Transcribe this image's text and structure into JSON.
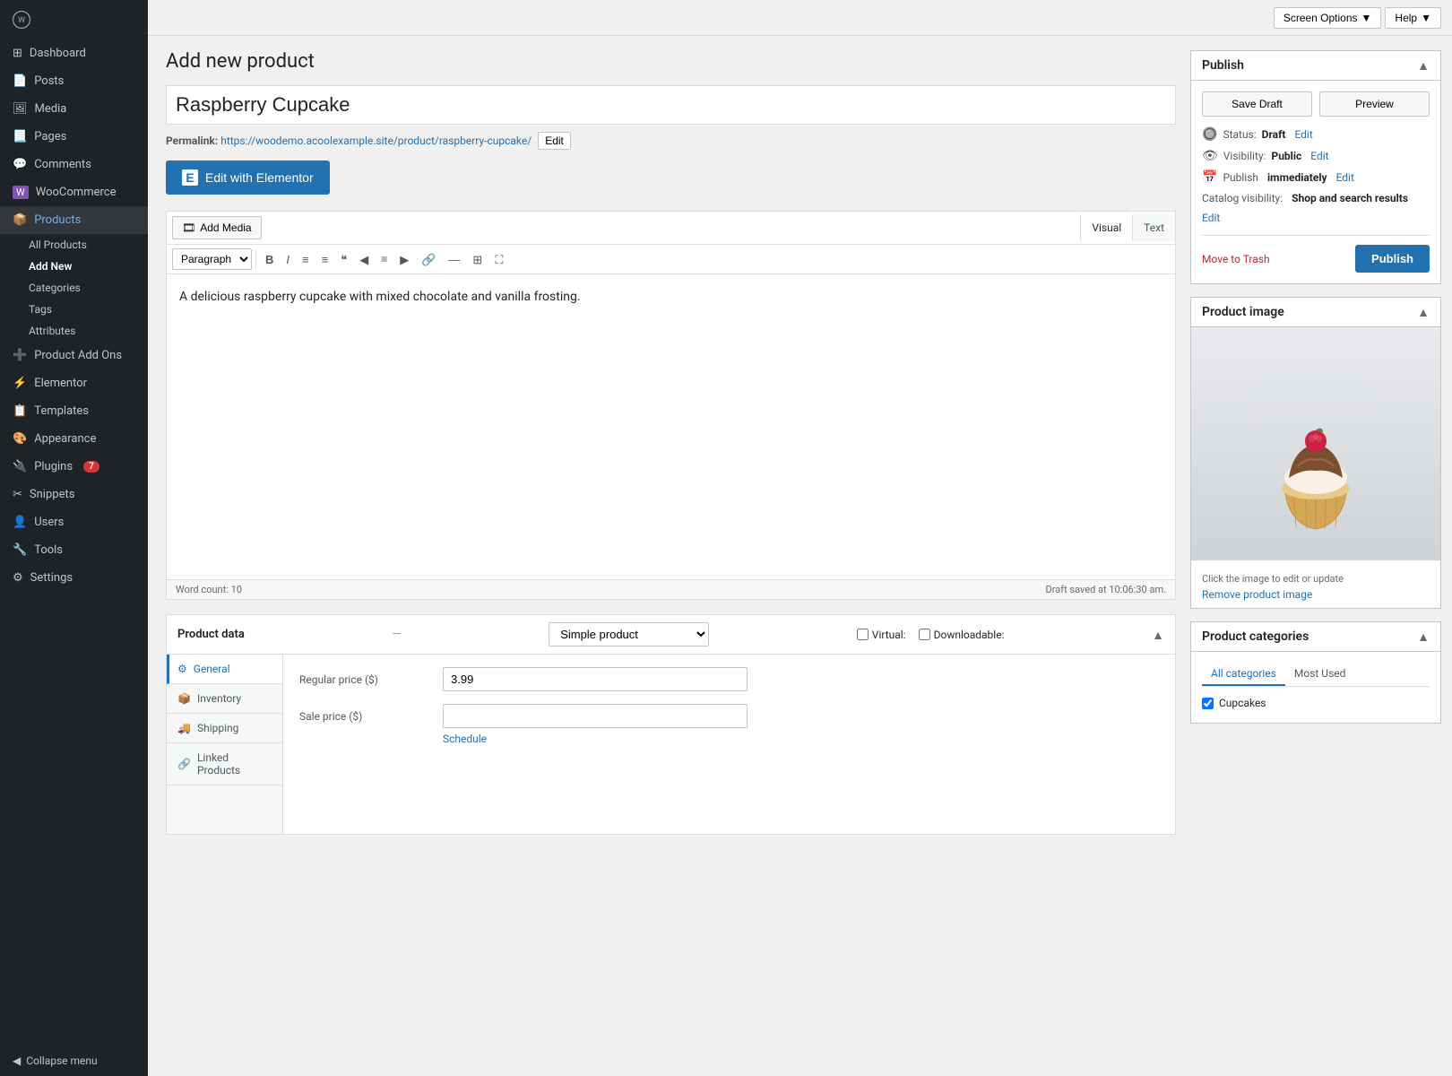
{
  "topbar": {
    "screen_options": "Screen Options",
    "help": "Help"
  },
  "sidebar": {
    "logo": "W",
    "items": [
      {
        "id": "dashboard",
        "label": "Dashboard",
        "icon": "⊞"
      },
      {
        "id": "posts",
        "label": "Posts",
        "icon": "📄"
      },
      {
        "id": "media",
        "label": "Media",
        "icon": "🖼"
      },
      {
        "id": "pages",
        "label": "Pages",
        "icon": "📃"
      },
      {
        "id": "comments",
        "label": "Comments",
        "icon": "💬"
      },
      {
        "id": "woocommerce",
        "label": "WooCommerce",
        "icon": "🛒"
      },
      {
        "id": "products",
        "label": "Products",
        "icon": "📦"
      },
      {
        "id": "product-add-ons",
        "label": "Product Add Ons",
        "icon": "➕"
      },
      {
        "id": "elementor",
        "label": "Elementor",
        "icon": "⚡"
      },
      {
        "id": "templates",
        "label": "Templates",
        "icon": "📋"
      },
      {
        "id": "appearance",
        "label": "Appearance",
        "icon": "🎨"
      },
      {
        "id": "plugins",
        "label": "Plugins",
        "icon": "🔌",
        "badge": "7"
      },
      {
        "id": "snippets",
        "label": "Snippets",
        "icon": "✂"
      },
      {
        "id": "users",
        "label": "Users",
        "icon": "👤"
      },
      {
        "id": "tools",
        "label": "Tools",
        "icon": "🔧"
      },
      {
        "id": "settings",
        "label": "Settings",
        "icon": "⚙"
      }
    ],
    "products_sub": [
      {
        "id": "all-products",
        "label": "All Products"
      },
      {
        "id": "add-new",
        "label": "Add New",
        "active": true
      },
      {
        "id": "categories",
        "label": "Categories"
      },
      {
        "id": "tags",
        "label": "Tags"
      },
      {
        "id": "attributes",
        "label": "Attributes"
      }
    ],
    "collapse": "Collapse menu"
  },
  "page": {
    "title": "Add new product",
    "product_title": "Raspberry Cupcake",
    "permalink_label": "Permalink:",
    "permalink_url": "https://woodemo.acoolexample.site/product/raspberry-cupcake/",
    "permalink_edit": "Edit"
  },
  "elementor_btn": "Edit with Elementor",
  "editor": {
    "add_media": "Add Media",
    "visual_tab": "Visual",
    "text_tab": "Text",
    "paragraph_label": "Paragraph",
    "toolbar_buttons": [
      "B",
      "I",
      "≡",
      "≡",
      "❝",
      "◀",
      "▶",
      "🔗",
      "—",
      "⊞",
      "⛶"
    ],
    "content": "A delicious raspberry cupcake with mixed chocolate and vanilla frosting.",
    "word_count": "Word count: 10",
    "draft_saved": "Draft saved at 10:06:30 am."
  },
  "product_data": {
    "label": "Product data",
    "type": "Simple product",
    "virtual_label": "Virtual:",
    "downloadable_label": "Downloadable:",
    "tabs": [
      {
        "id": "general",
        "label": "General",
        "icon": "⚙",
        "active": true
      },
      {
        "id": "inventory",
        "label": "Inventory",
        "icon": "📦"
      },
      {
        "id": "shipping",
        "label": "Shipping",
        "icon": "🚚"
      },
      {
        "id": "linked-products",
        "label": "Linked Products",
        "icon": "🔗"
      }
    ],
    "general": {
      "regular_price_label": "Regular price ($)",
      "regular_price_value": "3.99",
      "sale_price_label": "Sale price ($)",
      "sale_price_value": "",
      "schedule_link": "Schedule"
    }
  },
  "publish_box": {
    "title": "Publish",
    "save_draft": "Save Draft",
    "preview": "Preview",
    "status_label": "Status:",
    "status_value": "Draft",
    "status_edit": "Edit",
    "visibility_label": "Visibility:",
    "visibility_value": "Public",
    "visibility_edit": "Edit",
    "publish_time_label": "Publish",
    "publish_time_value": "immediately",
    "publish_time_edit": "Edit",
    "catalog_label": "Catalog visibility:",
    "catalog_value": "Shop and search results",
    "catalog_edit": "Edit",
    "move_to_trash": "Move to Trash",
    "publish_btn": "Publish"
  },
  "product_image": {
    "title": "Product image",
    "edit_caption": "Click the image to edit or update",
    "remove_link": "Remove product image"
  },
  "product_categories": {
    "title": "Product categories",
    "tab_all": "All categories",
    "tab_most_used": "Most Used",
    "categories": [
      {
        "label": "Cupcakes",
        "checked": true
      }
    ]
  }
}
